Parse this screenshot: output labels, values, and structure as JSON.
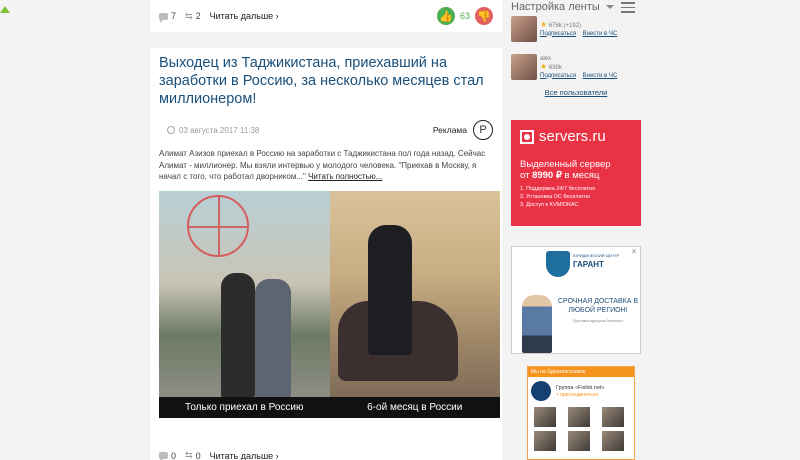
{
  "top_card": {
    "comments": "7",
    "shares": "2",
    "read_more": "Читать дальше ›",
    "likes": "63"
  },
  "article": {
    "title": "Выходец из Таджикистана, приехавший на заработки в Россию, за несколько месяцев стал миллионером!",
    "date": "03 августа 2017 11:38",
    "ad_label": "Реклама",
    "ruble_symbol": "Р",
    "excerpt": "Алимат Азизов приехал в Россию на заработки с Таджикистана пол года назад. Сейчас Алимат - миллионер. Мы взяли интервью у молодого человека. \"Приехав в Москву, я начал с того, что работал дворником...\"",
    "read_full": "Читать полностью...",
    "caption_left": "Только приехал в Россию",
    "caption_right": "6-ой месяц в России",
    "comments": "0",
    "shares": "0",
    "read_more": "Читать дальше ›"
  },
  "sidebar": {
    "feed_settings": "Настройка ленты",
    "users": [
      {
        "stats": "676k (+192)",
        "subscribe": "Подписаться",
        "block": "Внести в ЧС"
      },
      {
        "name": "alex",
        "stats": "638k",
        "subscribe": "Подписаться",
        "block": "Внести в ЧС"
      }
    ],
    "all_users": "Все пользователи"
  },
  "ad_servers": {
    "brand": "servers.ru",
    "headline_1": "Выделенный сервер",
    "headline_price_prefix": "от",
    "price": "8990 ₽",
    "headline_2": "в месяц",
    "features": [
      "1. Поддержка 24/7 бесплатно",
      "2. Установка ОС бесплатно",
      "3. Доступ к KVM/DRAC"
    ]
  },
  "ad_garant": {
    "close": "✕",
    "subtitle": "ЮРИДИЧЕСКИЙ ЦЕНТР",
    "name": "ГАРАНТ",
    "text": "СРОЧНАЯ ДОСТАВКА В ЛЮБОЙ РЕГИОН!",
    "note": "*Доставка курьером бесплатно"
  },
  "ok_widget": {
    "header": "Мы на Одноклассниках",
    "group_name": "Группа «Fishki.net»",
    "join": "+ присоединиться"
  },
  "colors": {
    "link": "#1a4f7a",
    "vote_up": "#4caf50",
    "vote_down": "#e36060",
    "servers_red": "#ea3245",
    "ok_orange": "#f7941e"
  }
}
